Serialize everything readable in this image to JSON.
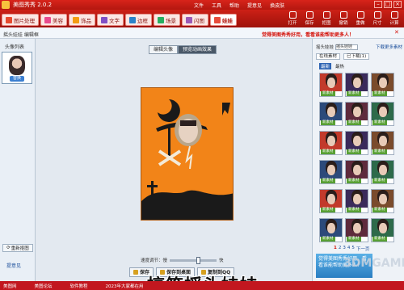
{
  "app": {
    "title": "美图秀秀 2.0.2",
    "menus": [
      "文件",
      "工具",
      "帮助",
      "提意见",
      "换皮肤"
    ]
  },
  "tabs": [
    {
      "label": "图片处理",
      "color": "#e64a2e",
      "active": false
    },
    {
      "label": "美容",
      "color": "#e84a8d",
      "active": false
    },
    {
      "label": "饰品",
      "color": "#f39c12",
      "active": false
    },
    {
      "label": "文字",
      "color": "#7f4fc4",
      "active": false
    },
    {
      "label": "边框",
      "color": "#2c82c9",
      "active": false
    },
    {
      "label": "场景",
      "color": "#27ae60",
      "active": false
    },
    {
      "label": "闪图",
      "color": "#9b59b6",
      "active": false
    },
    {
      "label": "娃娃",
      "color": "#e74c3c",
      "active": true
    }
  ],
  "tools": [
    "打开",
    "保存",
    "拒图",
    "撤销",
    "重做",
    "尺寸",
    "计算"
  ],
  "strip": {
    "breadcrumb": "摇头娃娃  编辑框",
    "promo": "觉得美图秀秀好用，看看谁能帮助更多人！"
  },
  "left": {
    "header": "头像列表",
    "thumb_badge": "替换",
    "reselect": "重新抠图",
    "link": "提意见"
  },
  "center": {
    "modes": [
      {
        "label": "编辑头像",
        "on": false
      },
      {
        "label": "预览动画效果",
        "on": true
      }
    ],
    "speed_label": "速度调节：慢",
    "speed_end": "快",
    "speed_value": 0.62,
    "actions": [
      "保存",
      "保存到桌面",
      "复制到QQ"
    ],
    "caption": "搞笑摇头娃娃"
  },
  "right": {
    "category_label": "摇头娃娃",
    "category_value": "摇头娃娃",
    "more": "下载更多素材",
    "tabs": [
      "在线素材",
      "已下载(1)"
    ],
    "filters": [
      "最新",
      "最热"
    ],
    "item_tags": [
      "新素材",
      "新素材",
      "新素材",
      "新素材",
      "新素材",
      "新素材",
      "新素材",
      "新素材",
      "新素材",
      "新素材",
      "新素材",
      "新素材",
      "新素材",
      "新素材",
      "新素材",
      "新素材",
      "新素材",
      "新素材"
    ],
    "pager": {
      "pages": [
        "1",
        "2",
        "3",
        "4",
        "5"
      ],
      "current": "1",
      "next": "下一页"
    },
    "ad": "觉得美图秀秀好用，看看谁能帮助更多人！"
  },
  "statusbar": [
    "美图网",
    "美图论坛",
    "软件教程",
    "2023年大家都在用"
  ],
  "watermark": "3DMGAME"
}
